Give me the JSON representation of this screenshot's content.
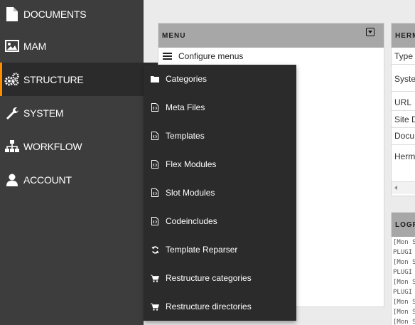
{
  "sidebar": {
    "items": [
      {
        "label": "DOCUMENTS",
        "icon": "document-icon"
      },
      {
        "label": "MAM",
        "icon": "image-icon"
      },
      {
        "label": "STRUCTURE",
        "icon": "gears-icon",
        "active": true
      },
      {
        "label": "SYSTEM",
        "icon": "wrench-icon"
      },
      {
        "label": "WORKFLOW",
        "icon": "sitemap-icon"
      },
      {
        "label": "ACCOUNT",
        "icon": "user-icon"
      }
    ]
  },
  "structure_menu": {
    "items": [
      {
        "label": "Categories",
        "icon": "folder-icon"
      },
      {
        "label": "Meta Files",
        "icon": "file-code-icon"
      },
      {
        "label": "Templates",
        "icon": "file-code-icon"
      },
      {
        "label": "Flex Modules",
        "icon": "file-code-icon"
      },
      {
        "label": "Slot Modules",
        "icon": "file-code-icon"
      },
      {
        "label": "Codeincludes",
        "icon": "file-code-icon"
      },
      {
        "label": "Template Reparser",
        "icon": "refresh-icon"
      },
      {
        "label": "Restructure categories",
        "icon": "cart-icon"
      },
      {
        "label": "Restructure directories",
        "icon": "cart-icon"
      }
    ]
  },
  "menu_panel": {
    "title": "MENU",
    "configure_label": "Configure menus"
  },
  "herm_panel": {
    "title": "HERM",
    "rows": [
      "Type",
      "Syste",
      "URL",
      "Site D",
      "Docu",
      "Herm"
    ]
  },
  "logs_panel": {
    "title": "LOGF",
    "lines": [
      "[Mon S",
      "PLUGI",
      "[Mon S",
      "PLUGI",
      "[Mon S",
      "PLUGI",
      "[Mon S",
      "[Mon S",
      "[Mon S"
    ]
  },
  "colors": {
    "sidebar_bg": "#3d3d3d",
    "active_bg": "#2b2b2b",
    "accent": "#ff8c00",
    "panel_header": "#a7a7a7"
  }
}
